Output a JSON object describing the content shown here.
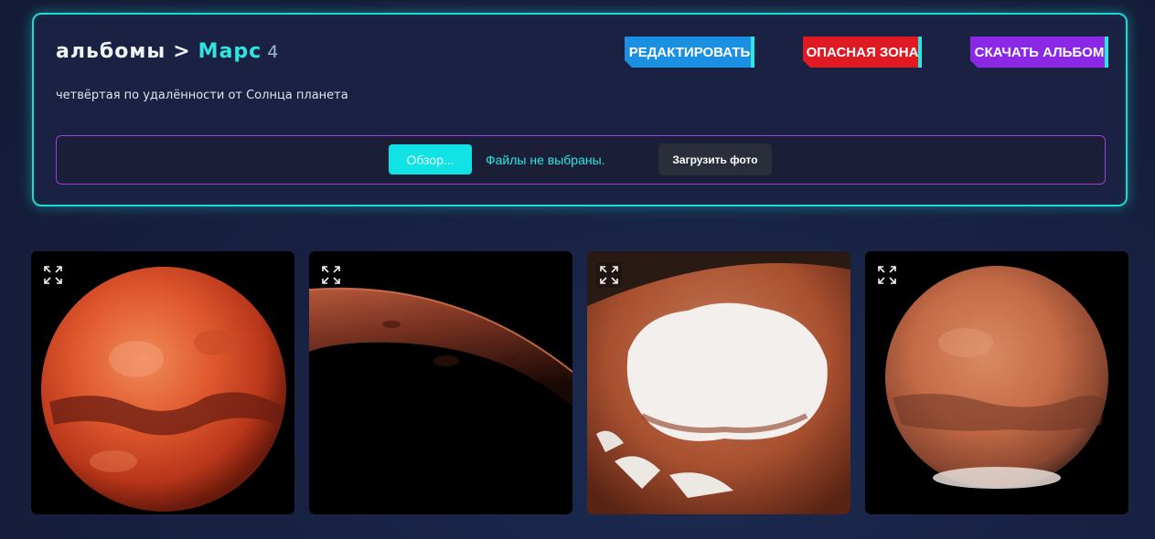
{
  "header": {
    "breadcrumb_root": "альбомы",
    "breadcrumb_separator": ">",
    "album_name": "Марс",
    "photo_count": "4",
    "description": "четвёртая по удалённости от Солнца планета"
  },
  "actions": {
    "edit_label": "РЕДАКТИРОВАТЬ",
    "danger_label": "ОПАСНАЯ ЗОНА",
    "download_label": "СКАЧАТЬ АЛЬБОМ"
  },
  "upload": {
    "browse_label": "Обзор...",
    "file_status": "Файлы не выбраны.",
    "upload_label": "Загрузить фото"
  },
  "colors": {
    "accent": "#2de6e0",
    "edit": "#1b8fe0",
    "danger": "#e01a22",
    "download": "#8a28e6",
    "upload_border": "#9d3fd8"
  },
  "photos": [
    {
      "subject": "mars-globe-red",
      "icon": "expand-icon"
    },
    {
      "subject": "mars-horizon",
      "icon": "expand-icon"
    },
    {
      "subject": "mars-polar-ice-cap",
      "icon": "expand-icon"
    },
    {
      "subject": "mars-globe-hubble",
      "icon": "expand-icon"
    }
  ]
}
